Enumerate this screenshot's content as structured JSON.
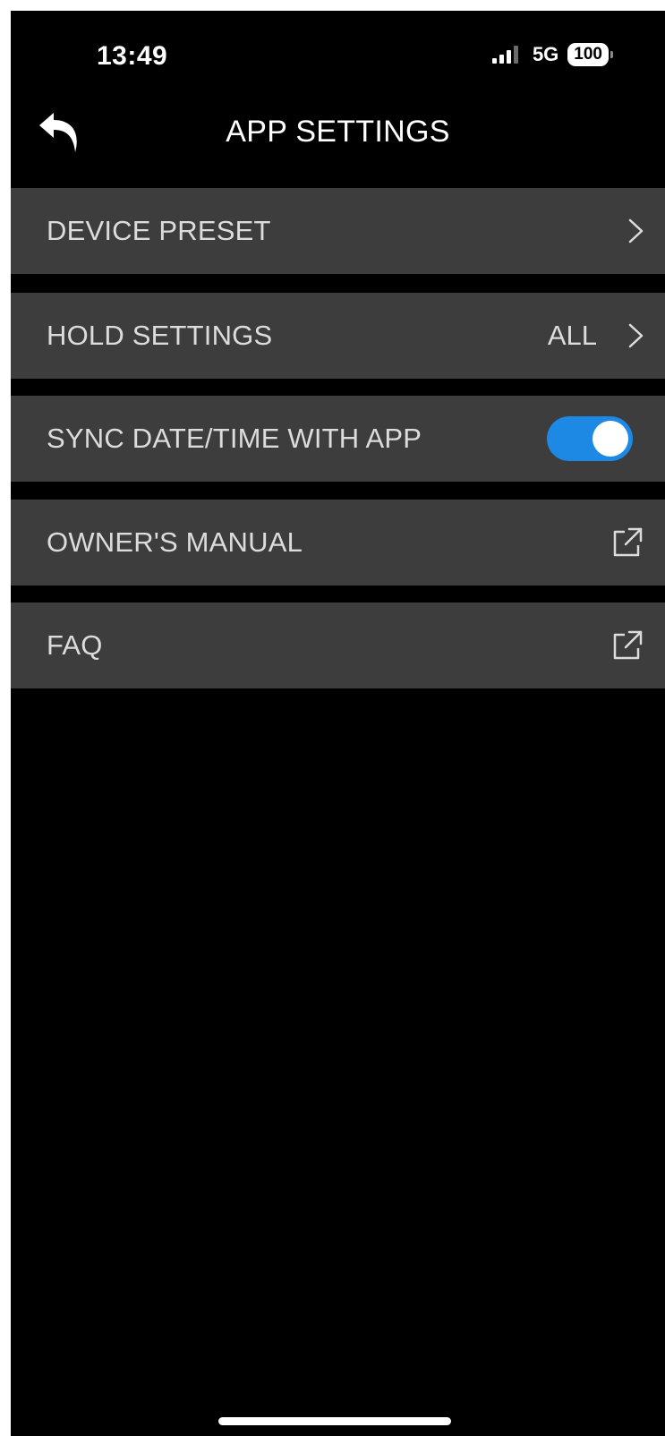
{
  "status_bar": {
    "time": "13:49",
    "network": "5G",
    "battery": "100"
  },
  "header": {
    "title": "APP SETTINGS",
    "back_icon": "back-arrow-icon"
  },
  "settings": {
    "device_preset": {
      "label": "DEVICE PRESET",
      "icon": "chevron-right-icon"
    },
    "hold_settings": {
      "label": "HOLD SETTINGS",
      "value": "ALL",
      "icon": "chevron-right-icon"
    },
    "sync_datetime": {
      "label": "SYNC DATE/TIME WITH APP",
      "enabled": true,
      "toggle_color": "#1e88e5"
    },
    "owners_manual": {
      "label": "OWNER'S MANUAL",
      "icon": "external-link-icon"
    },
    "faq": {
      "label": "FAQ",
      "icon": "external-link-icon"
    }
  }
}
